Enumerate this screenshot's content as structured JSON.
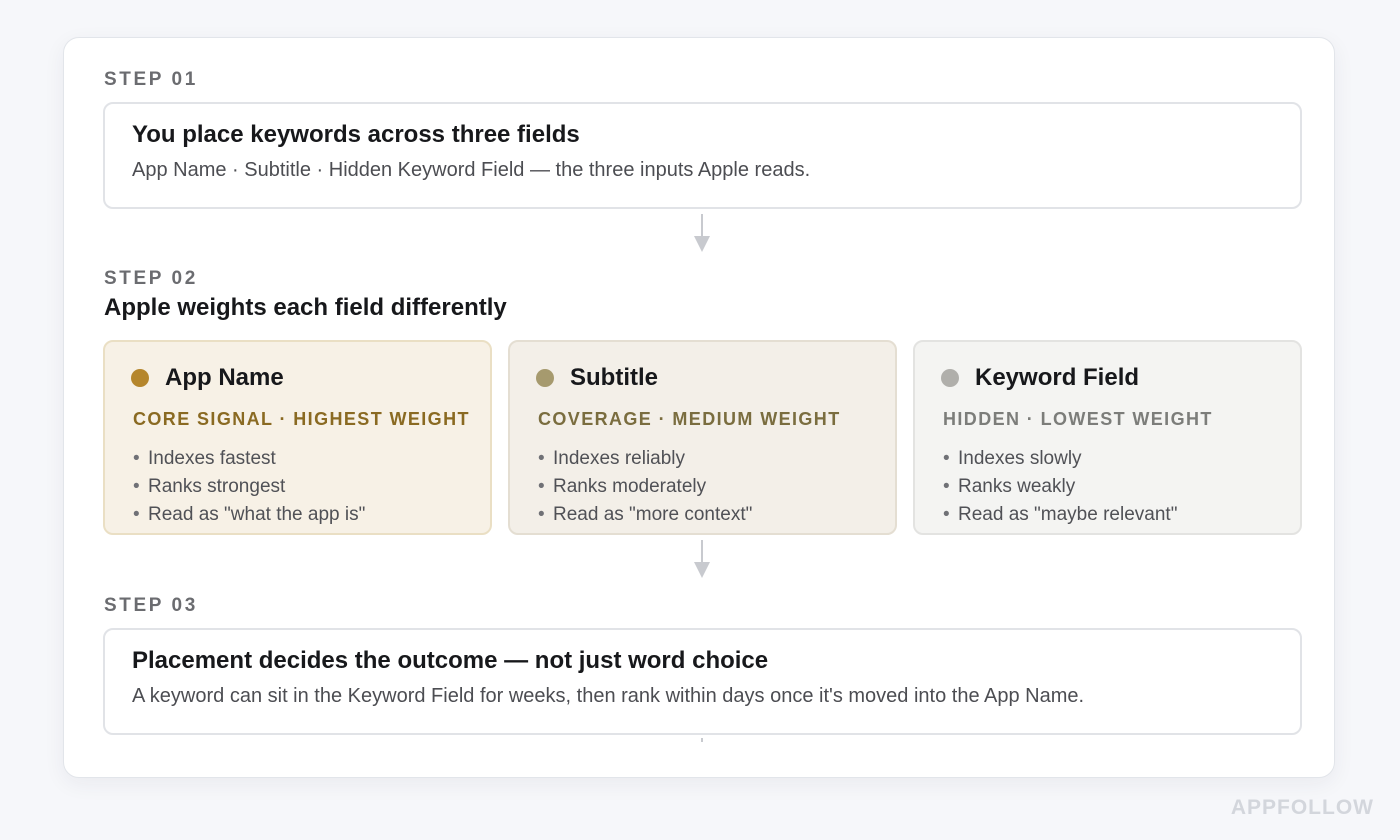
{
  "colors": {
    "page_background": "#f6f7fa",
    "step_label": "#6b6c70",
    "arrow": "#c8cacf",
    "app_name_accent": "#b5862c",
    "subtitle_accent": "#a69a6e",
    "keyword_accent": "#b0afab"
  },
  "step1": {
    "label": "STEP 01",
    "title": "You place keywords across three fields",
    "description": "App Name · Subtitle · Hidden Keyword Field — the three inputs Apple reads."
  },
  "step2": {
    "label": "STEP 02",
    "title": "Apple weights each field differently",
    "fields": [
      {
        "name": "App Name",
        "subtitle": "CORE SIGNAL · HIGHEST WEIGHT",
        "bullets": [
          "Indexes fastest",
          "Ranks strongest",
          "Read as \"what the app is\""
        ],
        "dot_color": "#b5862c",
        "subtitle_color": "#8a6a22",
        "background": "#f7f1e6",
        "border": "#eadfc4"
      },
      {
        "name": "Subtitle",
        "subtitle": "COVERAGE · MEDIUM WEIGHT",
        "bullets": [
          "Indexes reliably",
          "Ranks moderately",
          "Read as \"more context\""
        ],
        "dot_color": "#a69a6e",
        "subtitle_color": "#7a6d3f",
        "background": "#f3efe8",
        "border": "#e4ded2"
      },
      {
        "name": "Keyword Field",
        "subtitle": "HIDDEN · LOWEST WEIGHT",
        "bullets": [
          "Indexes slowly",
          "Ranks weakly",
          "Read as \"maybe relevant\""
        ],
        "dot_color": "#b0afab",
        "subtitle_color": "#7c7d7a",
        "background": "#f4f4f2",
        "border": "#e3e3e1"
      }
    ]
  },
  "step3": {
    "label": "STEP 03",
    "title": "Placement decides the outcome — not just word choice",
    "description": "A keyword can sit in the Keyword Field for weeks, then rank within days once it's moved into the App Name."
  },
  "bullet_char": "•",
  "brand": "APPFOLLOW"
}
